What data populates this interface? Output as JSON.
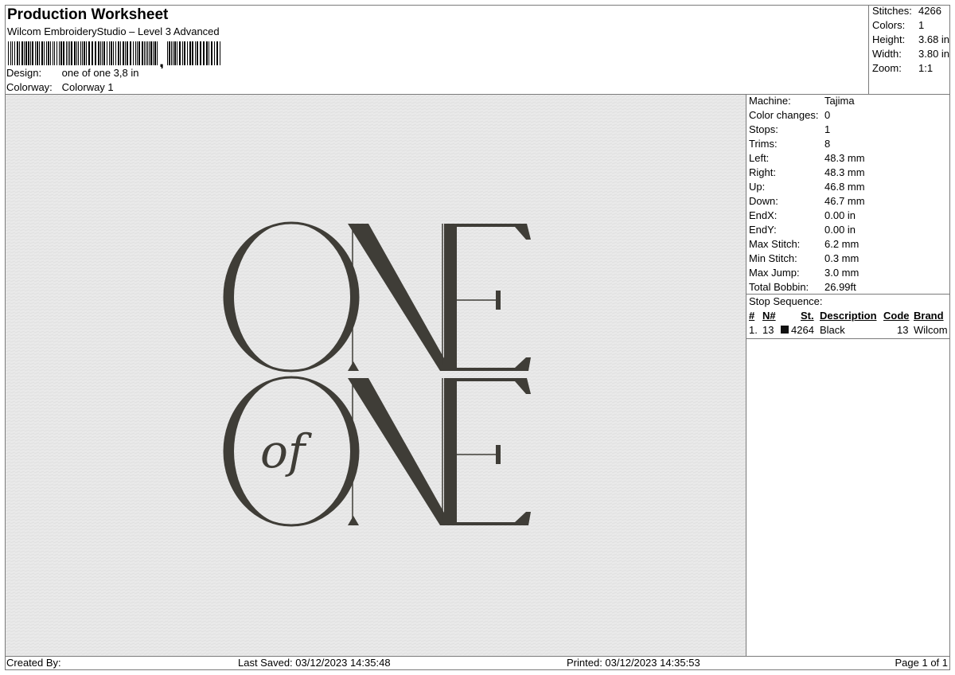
{
  "header": {
    "title": "Production Worksheet",
    "subtitle": "Wilcom EmbroideryStudio – Level 3 Advanced",
    "barcode_label": "barcode",
    "design_label": "Design:",
    "design_value": "one of one 3,8 in",
    "colorway_label": "Colorway:",
    "colorway_value": "Colorway 1"
  },
  "stats": [
    {
      "label": "Stitches:",
      "value": "4266"
    },
    {
      "label": "Colors:",
      "value": "1"
    },
    {
      "label": "Height:",
      "value": "3.68 in"
    },
    {
      "label": "Width:",
      "value": "3.80 in"
    },
    {
      "label": "Zoom:",
      "value": "1:1"
    }
  ],
  "machine": [
    {
      "label": "Machine:",
      "value": "Tajima"
    },
    {
      "label": "Color changes:",
      "value": "0"
    },
    {
      "label": "Stops:",
      "value": "1"
    },
    {
      "label": "Trims:",
      "value": "8"
    },
    {
      "label": "Left:",
      "value": "48.3 mm"
    },
    {
      "label": "Right:",
      "value": "48.3 mm"
    },
    {
      "label": "Up:",
      "value": "46.8 mm"
    },
    {
      "label": "Down:",
      "value": "46.7 mm"
    },
    {
      "label": "EndX:",
      "value": "0.00 in"
    },
    {
      "label": "EndY:",
      "value": "0.00 in"
    },
    {
      "label": "Max Stitch:",
      "value": "6.2 mm"
    },
    {
      "label": "Min Stitch:",
      "value": "0.3 mm"
    },
    {
      "label": "Max Jump:",
      "value": "3.0 mm"
    },
    {
      "label": "Total Bobbin:",
      "value": "26.99ft"
    }
  ],
  "stop_sequence": {
    "title": "Stop Sequence:",
    "headers": {
      "num": "#",
      "n": "N#",
      "st": "St.",
      "desc": "Description",
      "code": "Code",
      "brand": "Brand"
    },
    "rows": [
      {
        "num": "1.",
        "n": "13",
        "st": "4264",
        "desc": "Black",
        "code": "13",
        "brand": "Wilcom",
        "color": "#111111"
      }
    ]
  },
  "design": {
    "thread_color": "#3f3d37",
    "background_color": "#e9e9e9",
    "line1": "ONE",
    "line2_small": "of",
    "line2": "ONE"
  },
  "footer": {
    "created_by": "Created By:",
    "last_saved": "Last Saved: 03/12/2023 14:35:48",
    "printed": "Printed: 03/12/2023 14:35:53",
    "page": "Page 1 of 1"
  }
}
